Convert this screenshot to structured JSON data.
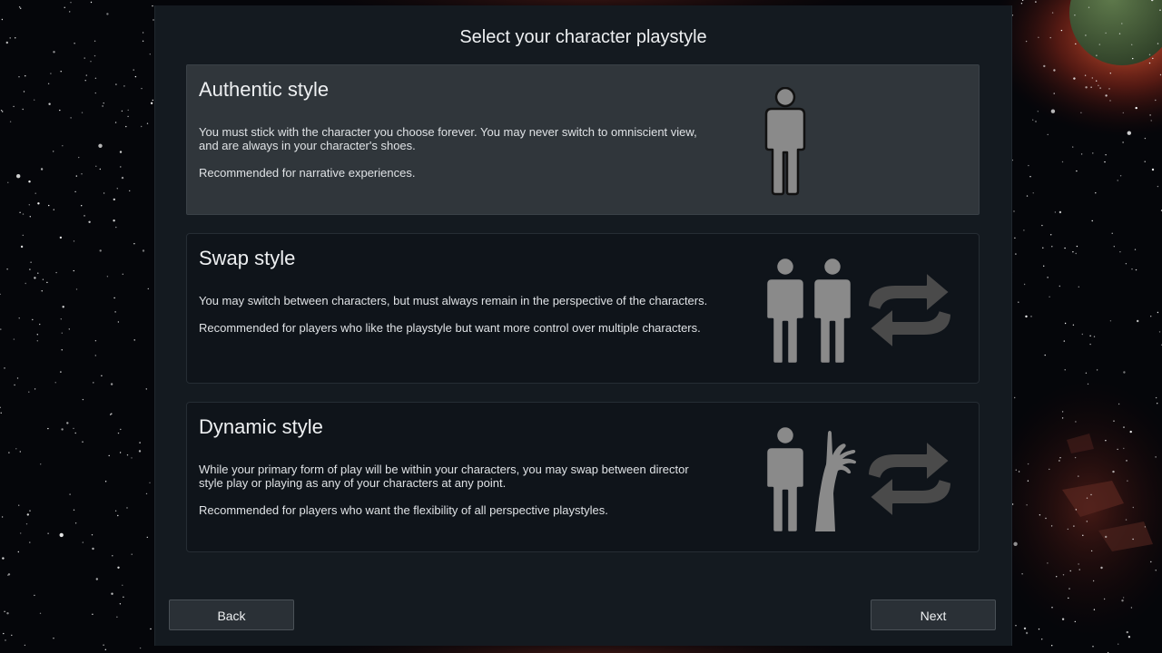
{
  "dialog": {
    "title": "Select your character playstyle"
  },
  "options": [
    {
      "title": "Authentic style",
      "desc1": "You must stick with the character you choose forever. You may never switch to omniscient view, and are always in your character's shoes.",
      "desc2": "Recommended for narrative experiences.",
      "selected": true,
      "icons": [
        "person-icon"
      ]
    },
    {
      "title": "Swap style",
      "desc1": "You may switch between characters, but must always remain in the perspective of the characters.",
      "desc2": "Recommended for players who like the playstyle but want more control over multiple characters.",
      "selected": false,
      "icons": [
        "person-icon",
        "person-icon",
        "swap-arrows-icon"
      ]
    },
    {
      "title": "Dynamic style",
      "desc1": "While your primary form of play will be within your characters, you may swap between director style play or playing as any of your characters at any point.",
      "desc2": "Recommended for players who want the flexibility of all perspective playstyles.",
      "selected": false,
      "icons": [
        "person-icon",
        "director-hand-icon",
        "swap-arrows-icon"
      ]
    }
  ],
  "buttons": {
    "back": "Back",
    "next": "Next"
  },
  "colors": {
    "dialog_bg": "#141a20",
    "card_bg": "#0f141a",
    "card_selected_bg": "#30363b",
    "icon_gray": "#8a8a8a"
  }
}
